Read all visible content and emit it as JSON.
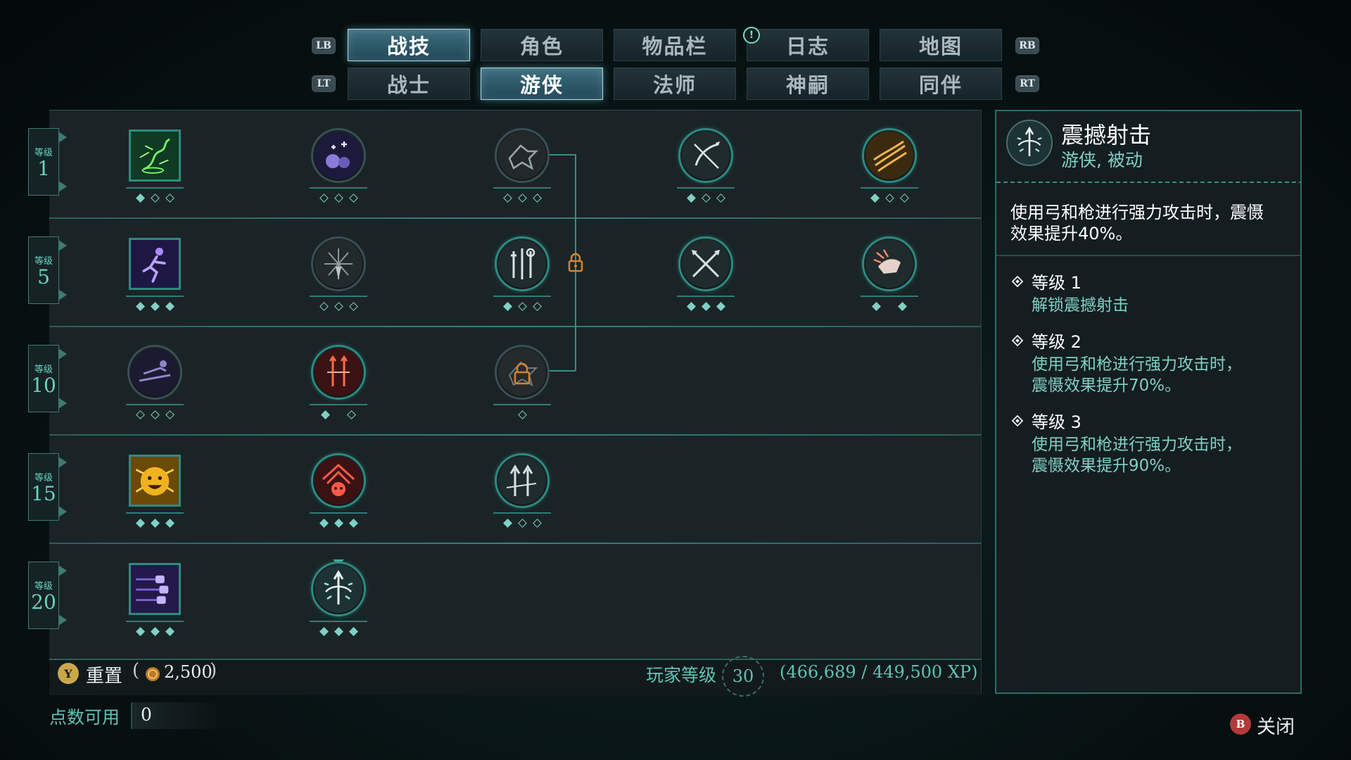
{
  "header": {
    "shoulder_left_top": "LB",
    "shoulder_right_top": "RB",
    "shoulder_left_bottom": "LT",
    "shoulder_right_bottom": "RT",
    "notification": "!",
    "main_tabs": [
      {
        "label": "战技",
        "active": true
      },
      {
        "label": "角色",
        "active": false
      },
      {
        "label": "物品栏",
        "active": false
      },
      {
        "label": "日志",
        "active": false
      },
      {
        "label": "地图",
        "active": false
      }
    ],
    "class_tabs": [
      {
        "label": "战士",
        "active": false
      },
      {
        "label": "游侠",
        "active": true
      },
      {
        "label": "法师",
        "active": false
      },
      {
        "label": "神嗣",
        "active": false
      },
      {
        "label": "同伴",
        "active": false
      }
    ]
  },
  "tiers": [
    {
      "label": "等级",
      "level": "1"
    },
    {
      "label": "等级",
      "level": "5"
    },
    {
      "label": "等级",
      "level": "10"
    },
    {
      "label": "等级",
      "level": "15"
    },
    {
      "label": "等级",
      "level": "20"
    }
  ],
  "skills": [
    {
      "tier": 1,
      "icon": "green-tornado-icon",
      "pips": [
        1,
        0,
        0
      ]
    },
    {
      "tier": 1,
      "icon": "bombs-icon",
      "pips": [
        0,
        0,
        0
      ]
    },
    {
      "tier": 1,
      "icon": "arrow-dash-icon",
      "pips": [
        0,
        0,
        0
      ]
    },
    {
      "tier": 1,
      "icon": "bow-shot-icon",
      "pips": [
        1,
        0,
        0
      ]
    },
    {
      "tier": 1,
      "icon": "claw-swipe-icon",
      "pips": [
        1,
        0,
        0
      ]
    },
    {
      "tier": 5,
      "icon": "sprint-icon",
      "pips": [
        1,
        1,
        1
      ]
    },
    {
      "tier": 5,
      "icon": "dagger-burst-icon",
      "pips": [
        0,
        0,
        0
      ]
    },
    {
      "tier": 5,
      "icon": "weapons-icon",
      "pips": [
        1,
        0,
        0
      ]
    },
    {
      "tier": 5,
      "icon": "crossed-arrows-icon",
      "pips": [
        1,
        1,
        1
      ]
    },
    {
      "tier": 5,
      "icon": "fist-impact-icon",
      "pips": [
        1,
        1
      ]
    },
    {
      "tier": 10,
      "icon": "slide-icon",
      "pips": [
        0,
        0,
        0
      ]
    },
    {
      "tier": 10,
      "icon": "red-daggers-icon",
      "pips": [
        1,
        0
      ]
    },
    {
      "tier": 10,
      "icon": "locked-skill-icon",
      "pips": [
        0
      ]
    },
    {
      "tier": 15,
      "icon": "beast-roar-icon",
      "pips": [
        1,
        1,
        1
      ]
    },
    {
      "tier": 15,
      "icon": "red-skull-icon",
      "pips": [
        1,
        1,
        1
      ]
    },
    {
      "tier": 15,
      "icon": "twin-arrows-icon",
      "pips": [
        1,
        0,
        0
      ]
    },
    {
      "tier": 20,
      "icon": "flying-fists-icon",
      "pips": [
        1,
        1,
        1
      ]
    },
    {
      "tier": 20,
      "icon": "stun-shot-icon",
      "pips": [
        1,
        1,
        1
      ],
      "selected": true
    }
  ],
  "bottom_bar": {
    "reset_button": "Y",
    "reset_label": "重置",
    "reset_cost_open": "(",
    "reset_cost": "2,500",
    "reset_cost_close": ")",
    "player_level_label": "玩家等级",
    "player_level": "30",
    "xp": "(466,689 / 449,500 XP)"
  },
  "points": {
    "label": "点数可用",
    "value": "0"
  },
  "close": {
    "button": "B",
    "label": "关闭"
  },
  "detail": {
    "title": "震撼射击",
    "subtitle": "游侠, 被动",
    "description_line1": "使用弓和枪进行强力攻击时，震慑",
    "description_line2": "效果提升40%。",
    "levels": [
      {
        "label": "等级 1",
        "lines": [
          "解锁震撼射击"
        ]
      },
      {
        "label": "等级 2",
        "lines": [
          "使用弓和枪进行强力攻击时，",
          "震慑效果提升70%。"
        ]
      },
      {
        "label": "等级 3",
        "lines": [
          "使用弓和枪进行强力攻击时，",
          "震慑效果提升90%。"
        ]
      }
    ]
  },
  "colors": {
    "accent": "#6ad2c0",
    "tab_active": "#3e6f80",
    "lock": "#d9822b"
  }
}
